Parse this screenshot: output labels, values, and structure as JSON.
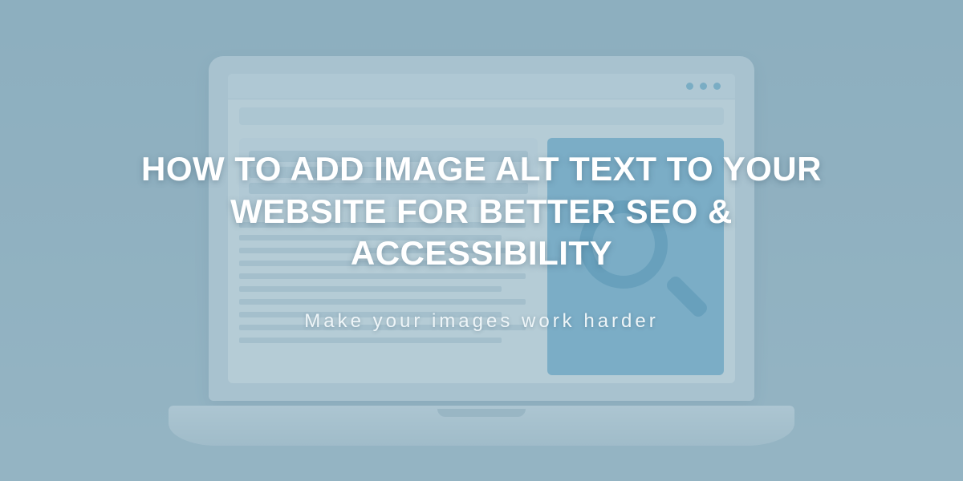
{
  "headline": "HOW TO ADD IMAGE ALT TEXT TO YOUR WEBSITE FOR BETTER SEO & ACCESSIBILITY",
  "subhead": "Make your images work harder"
}
